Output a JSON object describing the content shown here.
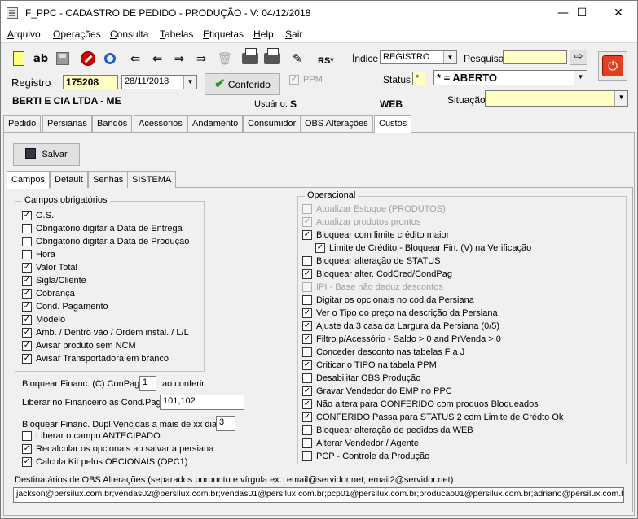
{
  "window": {
    "title": "F_PPC - CADASTRO DE PEDIDO - PRODUÇÃO - V: 04/12/2018",
    "minimize": "—",
    "maximize": "☐",
    "close": "✕"
  },
  "menu": [
    "Arquivo",
    "Operações",
    "Consulta",
    "Tabelas",
    "Etiquetas",
    "Help",
    "Sair"
  ],
  "toolbar": {
    "icons": [
      "new-document-icon",
      "spellcheck-icon",
      "save-disk-icon",
      "cancel-stop-icon",
      "search-lens-icon",
      "first-record-icon",
      "previous-record-icon",
      "next-record-icon",
      "last-record-icon",
      "delete-trash-icon",
      "print-icon",
      "print-preview-icon",
      "edit-sign-icon"
    ],
    "arrows": [
      "⇚",
      "⇐",
      "⇒",
      "⇛"
    ],
    "currency": "RS*",
    "indice_label": "Índice",
    "indice_value": "REGISTRO",
    "pesquisa_label": "Pesquisa",
    "pesquisa_value": "",
    "go_arrow": "⇨",
    "power_glyph": "⏻"
  },
  "header": {
    "registro_label": "Registro",
    "registro_value": "175208",
    "date_value": "28/11/2018",
    "conferido_label": "Conferido",
    "conferido_check": "✔",
    "ppm_label": "PPM",
    "status_label": "Status",
    "status_code": "*",
    "status_value": "* = ABERTO",
    "cliente": "BERTI E CIA LTDA - ME",
    "usuario_label": "Usuário:",
    "usuario_value": "S",
    "web_label": "WEB",
    "situacao_label": "Situação",
    "situacao_value": ""
  },
  "main_tabs": [
    "Pedido",
    "Persianas",
    "Bandôs",
    "Acessórios",
    "Andamento",
    "Consumidor",
    "OBS Alterações",
    "Custos"
  ],
  "salvar_label": "Salvar",
  "sub_tabs": [
    "Campos",
    "Default",
    "Senhas",
    "SISTEMA"
  ],
  "campos_obrigatorios": {
    "title": "Campos obrigatórios",
    "items": [
      {
        "label": "O.S.",
        "checked": true
      },
      {
        "label": "Obrigatório digitar a Data de Entrega",
        "checked": false
      },
      {
        "label": "Obrigatório digitar a Data de Produção",
        "checked": false
      },
      {
        "label": "Hora",
        "checked": false
      },
      {
        "label": "Valor Total",
        "checked": true
      },
      {
        "label": "Sigla/Cliente",
        "checked": true
      },
      {
        "label": "Cobrança",
        "checked": true
      },
      {
        "label": "Cond. Pagamento",
        "checked": true
      },
      {
        "label": "Modelo",
        "checked": true
      },
      {
        "label": "Amb. / Dentro vão / Ordem instal. / L/L",
        "checked": true
      },
      {
        "label": "Avisar produto sem NCM",
        "checked": true
      },
      {
        "label": "Avisar Transportadora em branco",
        "checked": true
      }
    ]
  },
  "financeiro": {
    "bloquear_label": "Bloquear Financ. (C) ConPag:",
    "bloquear_value": "1",
    "bloquear_suffix": "ao conferir.",
    "liberar_label": "Liberar no Financeiro as Cond.Pag.",
    "liberar_value": "101,102",
    "dupl_label": "Bloquear Financ. Dupl.Vencidas a mais de xx dias",
    "dupl_value": "3"
  },
  "extra_checks": [
    {
      "label": "Liberar o campo ANTECIPADO",
      "checked": false
    },
    {
      "label": "Recalcular os opcionais ao salvar a persiana",
      "checked": true
    },
    {
      "label": "Calcula Kit pelos OPCIONAIS (OPC1)",
      "checked": true
    }
  ],
  "operacional": {
    "title": "Operacional",
    "items": [
      {
        "label": "Atualizar Estoque (PRODUTOS)",
        "checked": false,
        "disabled": true,
        "indent": false
      },
      {
        "label": "Atualizar produtos prontos",
        "checked": true,
        "disabled": true,
        "indent": false
      },
      {
        "label": "Bloquear com limite crédito maior",
        "checked": true,
        "disabled": false,
        "indent": false
      },
      {
        "label": "Limite de Crédito - Bloquear Fin. (V) na Verificação",
        "checked": true,
        "disabled": false,
        "indent": true
      },
      {
        "label": "Bloquear alteração de STATUS",
        "checked": false,
        "disabled": false,
        "indent": false
      },
      {
        "label": "Bloquear alter. CodCred/CondPag",
        "checked": true,
        "disabled": false,
        "indent": false
      },
      {
        "label": "IPI - Base não deduz descontos",
        "checked": false,
        "disabled": true,
        "indent": false
      },
      {
        "label": "Digitar os opcionais no cod.da Persiana",
        "checked": false,
        "disabled": false,
        "indent": false
      },
      {
        "label": "Ver o Tipo do preço na descrição da Persiana",
        "checked": true,
        "disabled": false,
        "indent": false
      },
      {
        "label": "Ajuste da 3 casa da Largura da Persiana (0/5)",
        "checked": true,
        "disabled": false,
        "indent": false
      },
      {
        "label": "Filtro p/Acessório - Saldo > 0 and PrVenda > 0",
        "checked": true,
        "disabled": false,
        "indent": false
      },
      {
        "label": "Conceder desconto nas tabelas F a  J",
        "checked": false,
        "disabled": false,
        "indent": false
      },
      {
        "label": "Criticar o TIPO na tabela PPM",
        "checked": true,
        "disabled": false,
        "indent": false
      },
      {
        "label": "Desabilitar OBS Produção",
        "checked": false,
        "disabled": false,
        "indent": false
      },
      {
        "label": "Gravar Vendedor do EMP no PPC",
        "checked": true,
        "disabled": false,
        "indent": false
      },
      {
        "label": "Não altera para CONFERIDO com produos Bloqueados",
        "checked": true,
        "disabled": false,
        "indent": false
      },
      {
        "label": "CONFERIDO Passa para STATUS 2 com Limite de Crédto Ok",
        "checked": true,
        "disabled": false,
        "indent": false
      },
      {
        "label": "Bloquear alteração de pedidos da WEB",
        "checked": false,
        "disabled": false,
        "indent": false
      },
      {
        "label": "Alterar Vendedor / Agente",
        "checked": false,
        "disabled": false,
        "indent": false
      },
      {
        "label": "PCP - Controle da Produção",
        "checked": false,
        "disabled": false,
        "indent": false
      }
    ]
  },
  "destinatarios": {
    "label": "Destinatários de OBS Alterações (separados porponto e vírgula ex.: email@servidor.net; email2@servidor.net)",
    "value": "jackson@persilux.com.br;vendas02@persilux.com.br;vendas01@persilux.com.br;pcp01@persilux.com.br;producao01@persilux.com.br;adriano@persilux.com.br"
  },
  "check_glyph": "✓"
}
